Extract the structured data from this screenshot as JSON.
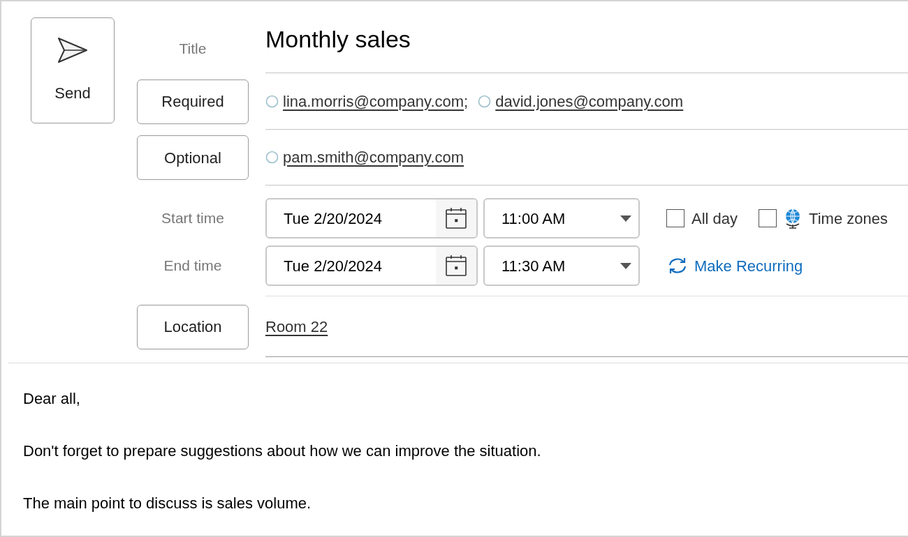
{
  "send_button": {
    "label": "Send"
  },
  "title": {
    "label": "Title",
    "value": "Monthly sales"
  },
  "required": {
    "label": "Required",
    "separator": ";",
    "attendees": [
      "lina.morris@company.com",
      "david.jones@company.com"
    ]
  },
  "optional": {
    "label": "Optional",
    "attendees": [
      "pam.smith@company.com"
    ]
  },
  "start": {
    "label": "Start time",
    "date": "Tue 2/20/2024",
    "time": "11:00 AM"
  },
  "end": {
    "label": "End time",
    "date": "Tue 2/20/2024",
    "time": "11:30 AM"
  },
  "options": [
    {
      "label": "All day",
      "checked": false,
      "globe": false
    },
    {
      "label": "Time zones",
      "checked": false,
      "globe": true
    }
  ],
  "recurring_link": "Make Recurring",
  "location": {
    "label": "Location",
    "value": "Room 22"
  },
  "body": [
    "Dear all,",
    "Don't forget to prepare suggestions about how we can improve the situation.",
    "The main point to discuss is sales volume."
  ]
}
